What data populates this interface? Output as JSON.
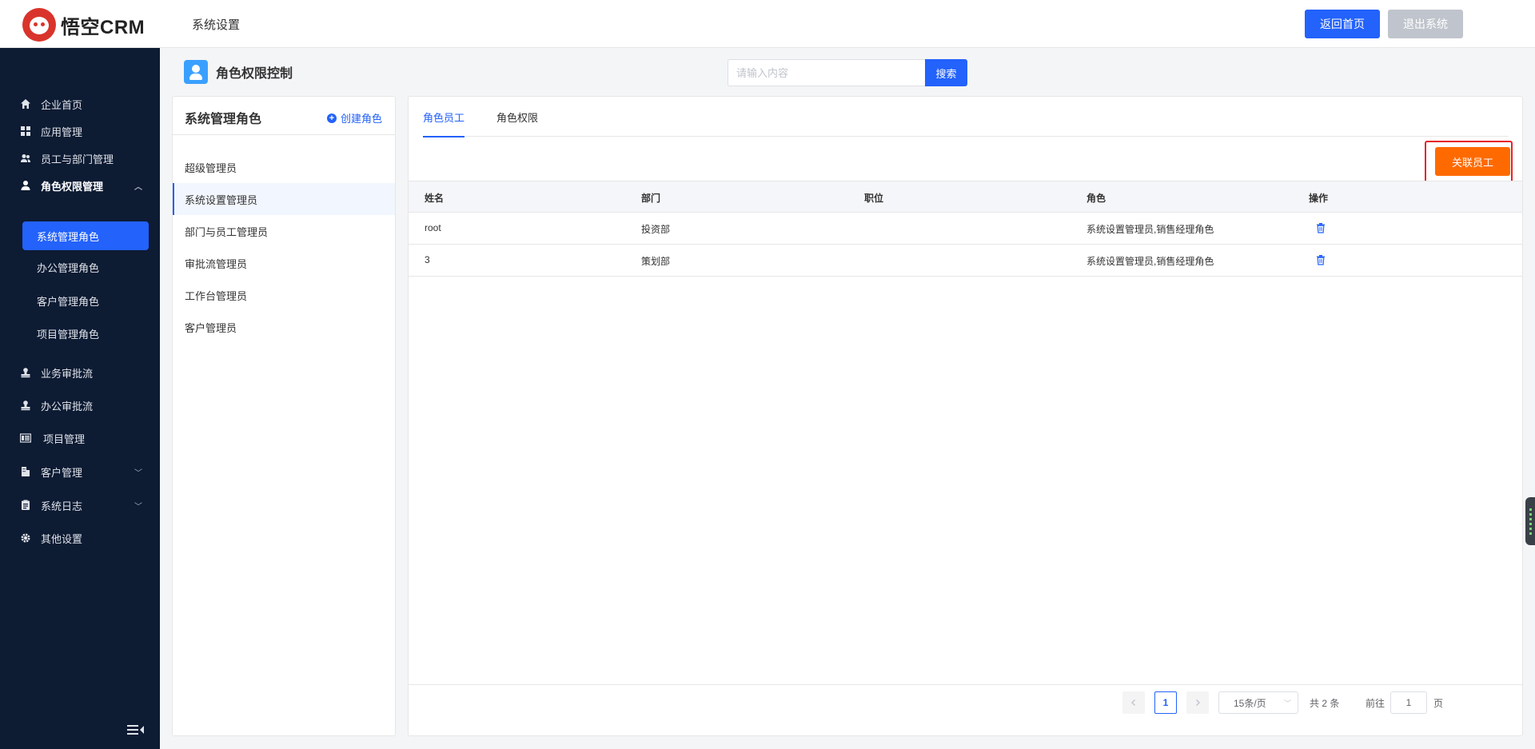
{
  "app": {
    "logo_text": "悟空CRM",
    "section_title": "系统设置"
  },
  "header": {
    "home_button": "返回首页",
    "logout_button": "退出系统"
  },
  "sidebar": {
    "items": [
      {
        "label": "企业首页",
        "icon": "home-icon"
      },
      {
        "label": "应用管理",
        "icon": "grid-icon"
      },
      {
        "label": "员工与部门管理",
        "icon": "users-icon"
      },
      {
        "label": "角色权限管理",
        "icon": "user-icon",
        "expanded": true
      },
      {
        "label": "业务审批流",
        "icon": "stamp-icon"
      },
      {
        "label": "办公审批流",
        "icon": "stamp-icon"
      },
      {
        "label": "项目管理",
        "icon": "list-icon"
      },
      {
        "label": "客户管理",
        "icon": "building-icon"
      },
      {
        "label": "系统日志",
        "icon": "log-icon"
      },
      {
        "label": "其他设置",
        "icon": "gear-icon"
      }
    ],
    "sub_items": [
      "系统管理角色",
      "办公管理角色",
      "客户管理角色",
      "项目管理角色"
    ],
    "active_sub": "系统管理角色"
  },
  "page": {
    "title": "角色权限控制",
    "search_placeholder": "请输入内容",
    "search_button": "搜索"
  },
  "roles_panel": {
    "title": "系统管理角色",
    "create_label": "创建角色",
    "roles": [
      "超级管理员",
      "系统设置管理员",
      "部门与员工管理员",
      "审批流管理员",
      "工作台管理员",
      "客户管理员"
    ],
    "active": "系统设置管理员"
  },
  "tabs": [
    {
      "label": "角色员工",
      "active": true
    },
    {
      "label": "角色权限",
      "active": false
    }
  ],
  "link_button": "关联员工",
  "table": {
    "columns": [
      "姓名",
      "部门",
      "职位",
      "角色",
      "操作"
    ],
    "rows": [
      {
        "name": "root",
        "dept": "投资部",
        "position": "",
        "role": "系统设置管理员,销售经理角色"
      },
      {
        "name": "3",
        "dept": "策划部",
        "position": "",
        "role": "系统设置管理员,销售经理角色"
      }
    ]
  },
  "pagination": {
    "current": "1",
    "page_size": "15条/页",
    "total": "共 2 条",
    "goto_label": "前往",
    "goto_value": "1",
    "page_label": "页"
  },
  "colors": {
    "primary": "#2362fb",
    "accent": "#ff6a00",
    "sidebar": "#0d1b33",
    "highlight": "#e6212a"
  }
}
